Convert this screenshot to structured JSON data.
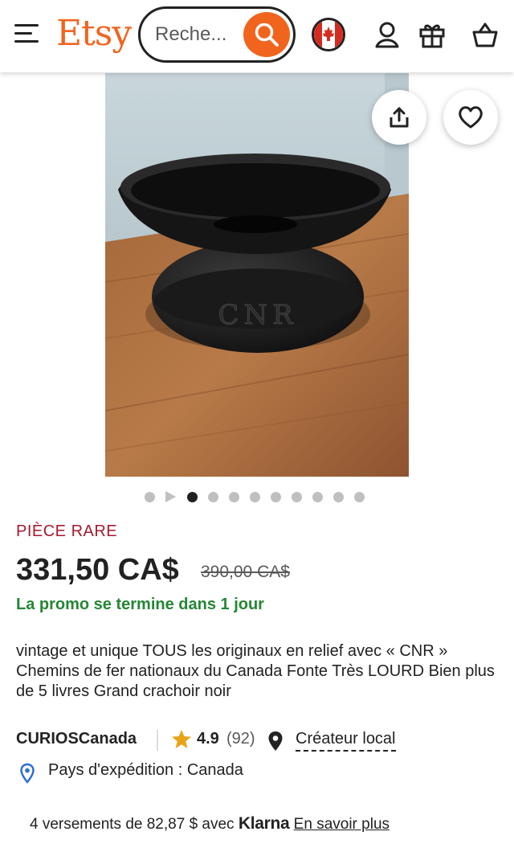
{
  "header": {
    "logo": "Etsy",
    "search_placeholder": "Recherche",
    "search_display": "Reche...",
    "icons": [
      "menu-icon",
      "search-icon",
      "canada-flag-icon",
      "account-icon",
      "gift-icon",
      "cart-icon"
    ]
  },
  "gallery": {
    "icons": [
      "share-icon",
      "heart-icon"
    ],
    "dots_total": 10,
    "active_dot": 0,
    "engraving": "CNR"
  },
  "listing": {
    "tag": "PIÈCE RARE",
    "price": "331,50 CA$",
    "original_price": "390,00 CA$",
    "promo": "La promo se termine dans 1 jour",
    "description": "vintage et unique TOUS les originaux en relief avec « CNR » Chemins de fer nationaux du Canada Fonte Très LOURD Bien plus de 5 livres Grand crachoir noir"
  },
  "shop": {
    "name": "CURIOSCanada",
    "rating": "4.9",
    "reviews": "(92)",
    "local_label": "Créateur local",
    "shipping": "Pays d'expédition : Canada"
  },
  "payment": {
    "text": "4 versements de 82,87 $ avec",
    "brand": "Klarna",
    "link": "En savoir plus"
  },
  "colors": {
    "brand": "#f1641e",
    "tag": "#a61a2e",
    "promo": "#258635",
    "pin": "#2f6fd6"
  }
}
